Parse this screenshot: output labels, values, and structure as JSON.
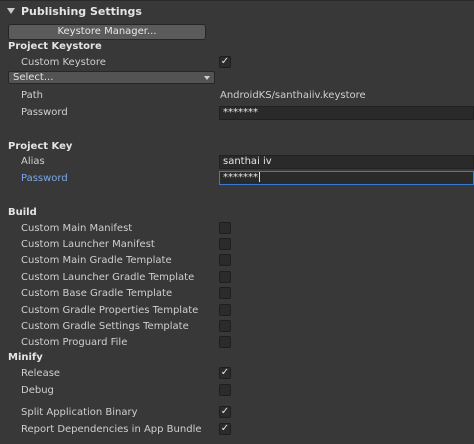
{
  "header": {
    "title": "Publishing Settings",
    "keystore_manager_button": "Keystore Manager..."
  },
  "project_keystore": {
    "section_title": "Project Keystore",
    "custom_keystore_label": "Custom Keystore",
    "custom_keystore_checked": true,
    "keystore_select_value": "Select...",
    "path_label": "Path",
    "path_value": "AndroidKS/santhaiiv.keystore",
    "password_label": "Password",
    "password_value": "*******"
  },
  "project_key": {
    "section_title": "Project Key",
    "alias_label": "Alias",
    "alias_value": "santhai iv",
    "password_label": "Password",
    "password_value": "*******"
  },
  "build": {
    "section_title": "Build",
    "items": [
      {
        "label": "Custom Main Manifest",
        "checked": false
      },
      {
        "label": "Custom Launcher Manifest",
        "checked": false
      },
      {
        "label": "Custom Main Gradle Template",
        "checked": false
      },
      {
        "label": "Custom Launcher Gradle Template",
        "checked": false
      },
      {
        "label": "Custom Base Gradle Template",
        "checked": false
      },
      {
        "label": "Custom Gradle Properties Template",
        "checked": false
      },
      {
        "label": "Custom Gradle Settings Template",
        "checked": false
      },
      {
        "label": "Custom Proguard File",
        "checked": false
      }
    ]
  },
  "minify": {
    "section_title": "Minify",
    "items": [
      {
        "label": "Release",
        "checked": true
      },
      {
        "label": "Debug",
        "checked": false
      }
    ]
  },
  "other": {
    "items": [
      {
        "label": "Split Application Binary",
        "checked": true
      },
      {
        "label": "Report Dependencies in App Bundle",
        "checked": true
      }
    ]
  },
  "check_glyph": "✓"
}
